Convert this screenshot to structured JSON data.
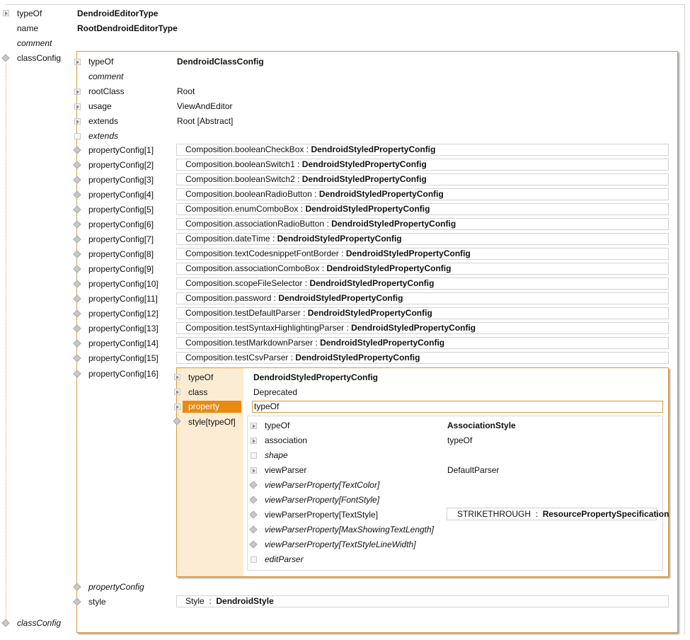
{
  "root": {
    "rows": [
      {
        "name": "typeOf",
        "value": "DendroidEditorType",
        "icon": "expand-triangle-icon"
      },
      {
        "name": "name",
        "value": "RootDendroidEditorType",
        "icon": ""
      },
      {
        "name": "comment",
        "value": "",
        "icon": ""
      },
      {
        "name": "classConfig",
        "value": "",
        "icon": "collection-diamond-icon"
      }
    ],
    "classConfig_tail_label": "classConfig"
  },
  "classConfig": {
    "typeOf_label": "typeOf",
    "typeOf_value": "DendroidClassConfig",
    "comment_label": "comment",
    "rootClass_label": "rootClass",
    "rootClass_value": "Root",
    "usage_label": "usage",
    "usage_value": "ViewAndEditor",
    "extends_label": "extends",
    "extends_value": "Root [Abstract]",
    "extends2_label": "extends",
    "propertyConfigs": [
      {
        "label": "propertyConfig[1]",
        "name": "Composition.booleanCheckBox",
        "type": "DendroidStyledPropertyConfig"
      },
      {
        "label": "propertyConfig[2]",
        "name": "Composition.booleanSwitch1",
        "type": "DendroidStyledPropertyConfig"
      },
      {
        "label": "propertyConfig[3]",
        "name": "Composition.booleanSwitch2",
        "type": "DendroidStyledPropertyConfig"
      },
      {
        "label": "propertyConfig[4]",
        "name": "Composition.booleanRadioButton",
        "type": "DendroidStyledPropertyConfig"
      },
      {
        "label": "propertyConfig[5]",
        "name": "Composition.enumComboBox",
        "type": "DendroidStyledPropertyConfig"
      },
      {
        "label": "propertyConfig[6]",
        "name": "Composition.associationRadioButton",
        "type": "DendroidStyledPropertyConfig"
      },
      {
        "label": "propertyConfig[7]",
        "name": "Composition.dateTime",
        "type": "DendroidStyledPropertyConfig"
      },
      {
        "label": "propertyConfig[8]",
        "name": "Composition.textCodesnippetFontBorder",
        "type": "DendroidStyledPropertyConfig"
      },
      {
        "label": "propertyConfig[9]",
        "name": "Composition.associationComboBox",
        "type": "DendroidStyledPropertyConfig"
      },
      {
        "label": "propertyConfig[10]",
        "name": "Composition.scopeFileSelector",
        "type": "DendroidStyledPropertyConfig"
      },
      {
        "label": "propertyConfig[11]",
        "name": "Composition.password",
        "type": "DendroidStyledPropertyConfig"
      },
      {
        "label": "propertyConfig[12]",
        "name": "Composition.testDefaultParser",
        "type": "DendroidStyledPropertyConfig"
      },
      {
        "label": "propertyConfig[13]",
        "name": "Composition.testSyntaxHighlightingParser",
        "type": "DendroidStyledPropertyConfig"
      },
      {
        "label": "propertyConfig[14]",
        "name": "Composition.testMarkdownParser",
        "type": "DendroidStyledPropertyConfig"
      },
      {
        "label": "propertyConfig[15]",
        "name": "Composition.testCsvParser",
        "type": "DendroidStyledPropertyConfig"
      }
    ],
    "propertyConfig16_label": "propertyConfig[16]",
    "propertyConfig_tail_label": "propertyConfig",
    "style_label": "style",
    "style_ref_name": "Style",
    "style_ref_type": "DendroidStyle"
  },
  "styledConfig": {
    "typeOf_label": "typeOf",
    "typeOf_value": "DendroidStyledPropertyConfig",
    "class_label": "class",
    "class_value": "Deprecated",
    "property_label": "property",
    "property_value": "typeOf",
    "style_label": "style[typeOf]"
  },
  "associationStyle": {
    "rows": [
      {
        "label": "typeOf",
        "value": "AssociationStyle",
        "italic": false,
        "bold": true
      },
      {
        "label": "association",
        "value": "typeOf",
        "italic": false,
        "bold": false
      },
      {
        "label": "shape",
        "value": "",
        "italic": true,
        "bold": false
      },
      {
        "label": "viewParser",
        "value": "DefaultParser",
        "italic": false,
        "bold": false
      },
      {
        "label": "viewParserProperty[TextColor]",
        "value": "",
        "italic": true,
        "bold": false
      },
      {
        "label": "viewParserProperty[FontStyle]",
        "value": "",
        "italic": true,
        "bold": false
      },
      {
        "label": "viewParserProperty[TextStyle]",
        "value": "",
        "italic": false,
        "bold": false
      },
      {
        "label": "viewParserProperty[MaxShowingTextLength]",
        "value": "",
        "italic": true,
        "bold": false
      },
      {
        "label": "viewParserProperty[TextStyleLineWidth]",
        "value": "",
        "italic": true,
        "bold": false
      },
      {
        "label": "editParser",
        "value": "",
        "italic": true,
        "bold": false
      }
    ],
    "textStyle_ref_name": "STRIKETHROUGH",
    "textStyle_ref_type": "ResourcePropertySpecification"
  },
  "colors": {
    "accent": "#e98b12",
    "frame": "#d69a3c",
    "highlight_bg": "#fcecd3"
  }
}
